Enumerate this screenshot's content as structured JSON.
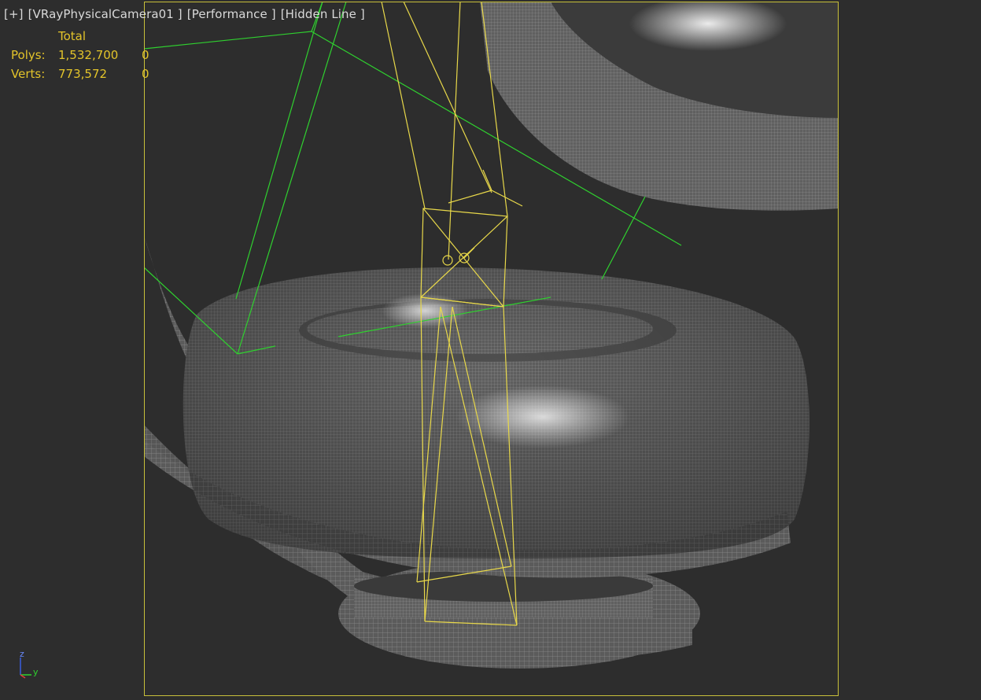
{
  "viewport": {
    "label": {
      "plus": "[+]",
      "camera": "[VRayPhysicalCamera01 ]",
      "mode": "[Performance ]",
      "shading": "[Hidden Line ]"
    },
    "stats": {
      "header": "Total",
      "rows": [
        {
          "label": "Polys:",
          "total": "1,532,700",
          "selected": "0"
        },
        {
          "label": "Verts:",
          "total": "773,572",
          "selected": "0"
        }
      ]
    },
    "axis": {
      "z": "z",
      "y": "y"
    }
  },
  "colors": {
    "background": "#2d2d2d",
    "label_text": "#d9d9d9",
    "stats_text": "#e3c42a",
    "safe_frame": "#c8c03a",
    "camera_gizmo": "#e8d84a",
    "target_lines": "#2fd12f",
    "mesh_fill": "#5a5a5a",
    "mesh_wire": "#a0a0a0"
  }
}
